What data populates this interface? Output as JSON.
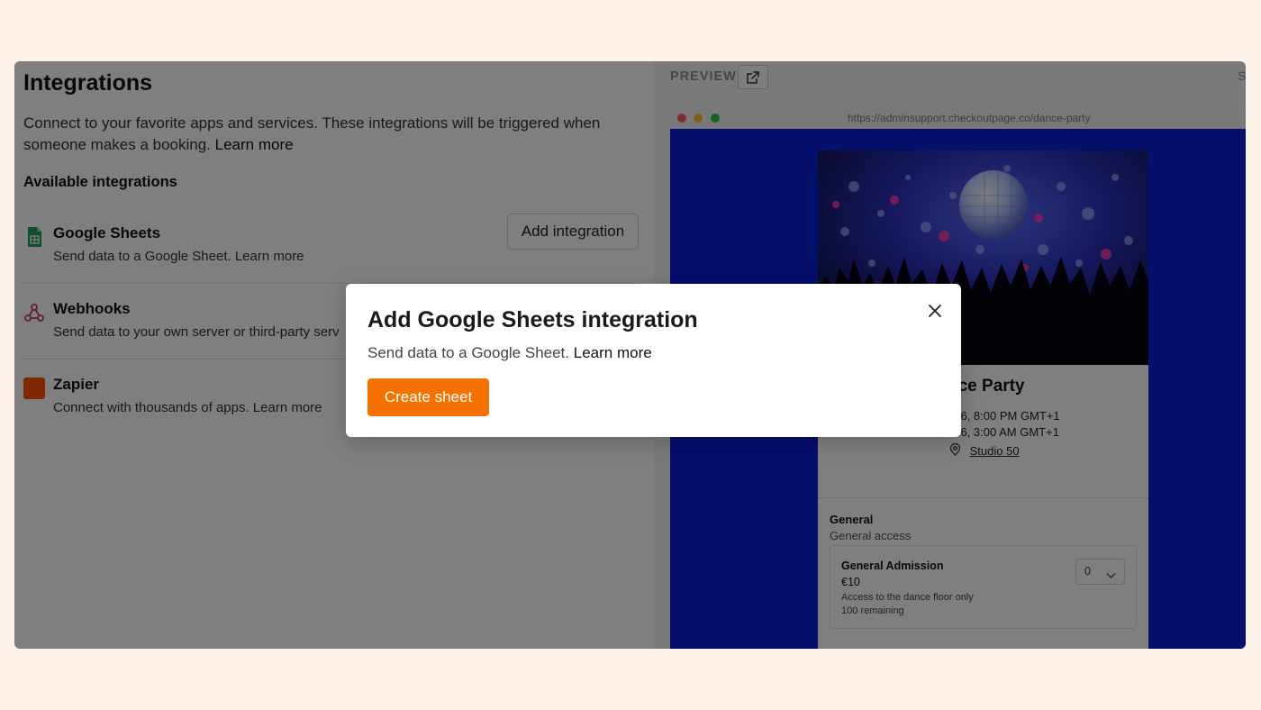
{
  "integrations_page": {
    "title": "Integrations",
    "description": "Connect to your favorite apps and services. These integrations will be triggered when someone makes a booking.",
    "description_link": "Learn more",
    "available_heading": "Available integrations",
    "items": [
      {
        "name": "Google Sheets",
        "icon": "google-sheets-icon",
        "description": "Send data to a Google Sheet. Learn more",
        "action": "Add integration"
      },
      {
        "name": "Webhooks",
        "icon": "webhook-icon",
        "description": "Send data to your own server or third-party serv"
      },
      {
        "name": "Zapier",
        "icon": "zapier-icon",
        "description": "Connect with thousands of apps. Learn more"
      }
    ]
  },
  "preview": {
    "label": "PREVIEW",
    "clipped_text": "S",
    "url": "https://adminsupport.checkoutpage.co/dance-party",
    "event": {
      "title": "nce Party",
      "start": "026, 8:00 PM GMT+1",
      "end": "026, 3:00 AM GMT+1",
      "location": "Studio 50"
    },
    "section": {
      "heading": "General",
      "subheading": "General access",
      "ticket": {
        "name": "General Admission",
        "price": "€10",
        "description": "Access to the dance floor only",
        "remaining": "100 remaining",
        "quantity": "0"
      }
    }
  },
  "modal": {
    "title": "Add Google Sheets integration",
    "description": "Send data to a Google Sheet.",
    "description_link": "Learn more",
    "cta": "Create sheet"
  },
  "colors": {
    "page_bg": "#fdf3ea",
    "accent": "#f57200",
    "preview_bg": "#0a1fd9",
    "overlay": "rgba(0,0,0,0.5)",
    "sheets_green": "#1f9d55",
    "zapier_orange": "#ff4f00"
  }
}
